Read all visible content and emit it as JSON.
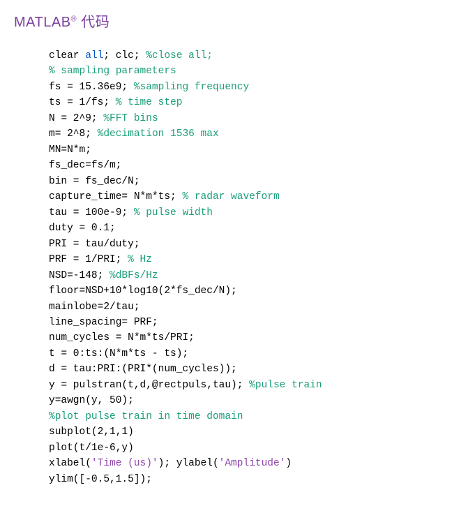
{
  "heading": {
    "brand": "MATLAB",
    "reg": "®",
    "suffix": " 代码"
  },
  "code": {
    "l1a": "clear ",
    "l1b": "all",
    "l1c": "; clc; ",
    "l1d": "%close all;",
    "l2": "% sampling parameters",
    "l3a": "fs = 15.36e9; ",
    "l3b": "%sampling frequency",
    "l4a": "ts = 1/fs; ",
    "l4b": "% time step",
    "l5a": "N = 2^9; ",
    "l5b": "%FFT bins",
    "l6a": "m= 2^8; ",
    "l6b": "%decimation 1536 max",
    "l7": "MN=N*m;",
    "l8": "fs_dec=fs/m;",
    "l9": "bin = fs_dec/N;",
    "l10a": "capture_time= N*m*ts; ",
    "l10b": "% radar waveform",
    "l11a": "tau = 100e-9; ",
    "l11b": "% pulse width",
    "l12": "duty = 0.1;",
    "l13": "PRI = tau/duty;",
    "l14a": "PRF = 1/PRI; ",
    "l14b": "% Hz",
    "l15a": "NSD=-148; ",
    "l15b": "%dBFs/Hz",
    "l16": "floor=NSD+10*log10(2*fs_dec/N);",
    "l17": "mainlobe=2/tau;",
    "l18": "line_spacing= PRF;",
    "l19": "num_cycles = N*m*ts/PRI;",
    "l20": "t = 0:ts:(N*m*ts - ts);",
    "l21": "d = tau:PRI:(PRI*(num_cycles));",
    "l22a": "y = pulstran(t,d,@rectpuls,tau); ",
    "l22b": "%pulse train",
    "l23": "y=awgn(y, 50);",
    "l24": "%plot pulse train in time domain",
    "l25": "subplot(2,1,1)",
    "l26": "plot(t/1e-6,y)",
    "l27a": "xlabel(",
    "l27b": "'Time (us)'",
    "l27c": "); ylabel(",
    "l27d": "'Amplitude'",
    "l27e": ")",
    "l28": "ylim([-0.5,1.5]);"
  }
}
